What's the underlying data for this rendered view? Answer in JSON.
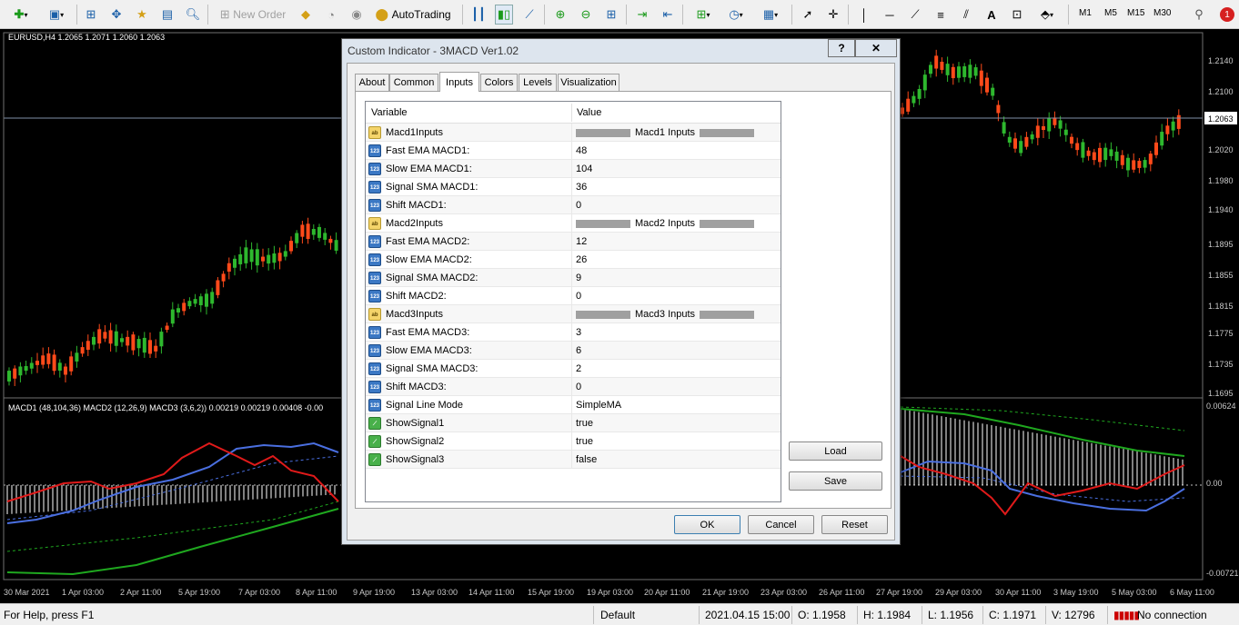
{
  "toolbar": {
    "new_order": "New Order",
    "autotrading": "AutoTrading",
    "timeframes": [
      "M1",
      "M5",
      "M15",
      "M30"
    ],
    "notification_count": "1"
  },
  "chart": {
    "symbol_info": "EURUSD,H4  1.2065 1.2071 1.2060 1.2063",
    "current_price": "1.2063",
    "price_labels": [
      "1.2140",
      "1.2100",
      "1.2020",
      "1.1980",
      "1.1940",
      "1.1895",
      "1.1855",
      "1.1815",
      "1.1775",
      "1.1735",
      "1.1695"
    ],
    "indicator_info": "MACD1 (48,104,36) MACD2 (12,26,9) MACD3 (3,6,2)) 0.00219 0.00219 0.00408 -0.00",
    "indicator_labels": [
      "0.00624",
      "0.00",
      "-0.00721"
    ],
    "time_labels": [
      "30 Mar 2021",
      "1 Apr 03:00",
      "2 Apr 11:00",
      "5 Apr 19:00",
      "7 Apr 03:00",
      "8 Apr 11:00",
      "9 Apr 19:00",
      "13 Apr 03:00",
      "14 Apr 11:00",
      "15 Apr 19:00",
      "19 Apr 03:00",
      "20 Apr 11:00",
      "21 Apr 19:00",
      "23 Apr 03:00",
      "26 Apr 11:00",
      "27 Apr 19:00",
      "29 Apr 03:00",
      "30 Apr 11:00",
      "3 May 19:00",
      "5 May 03:00",
      "6 May 11:00"
    ]
  },
  "dialog": {
    "title": "Custom Indicator - 3MACD Ver1.02",
    "help_button": "?",
    "close_button": "✕",
    "tabs": [
      "About",
      "Common",
      "Inputs",
      "Colors",
      "Levels",
      "Visualization"
    ],
    "active_tab": "Inputs",
    "grid_header": {
      "variable": "Variable",
      "value": "Value"
    },
    "rows": [
      {
        "type": "group",
        "variable": "Macd1Inputs",
        "value": "Macd1 Inputs"
      },
      {
        "type": "number",
        "variable": "Fast EMA MACD1:",
        "value": "48"
      },
      {
        "type": "number",
        "variable": "Slow EMA MACD1:",
        "value": "104"
      },
      {
        "type": "number",
        "variable": "Signal SMA MACD1:",
        "value": "36"
      },
      {
        "type": "number",
        "variable": "Shift MACD1:",
        "value": "0"
      },
      {
        "type": "group",
        "variable": "Macd2Inputs",
        "value": "Macd2 Inputs"
      },
      {
        "type": "number",
        "variable": "Fast EMA MACD2:",
        "value": "12"
      },
      {
        "type": "number",
        "variable": "Slow EMA MACD2:",
        "value": "26"
      },
      {
        "type": "number",
        "variable": "Signal SMA MACD2:",
        "value": "9"
      },
      {
        "type": "number",
        "variable": "Shift MACD2:",
        "value": "0"
      },
      {
        "type": "group",
        "variable": "Macd3Inputs",
        "value": "Macd3 Inputs"
      },
      {
        "type": "number",
        "variable": "Fast EMA MACD3:",
        "value": "3"
      },
      {
        "type": "number",
        "variable": "Slow EMA MACD3:",
        "value": "6"
      },
      {
        "type": "number",
        "variable": "Signal SMA MACD3:",
        "value": "2"
      },
      {
        "type": "number",
        "variable": "Shift MACD3:",
        "value": "0"
      },
      {
        "type": "number",
        "variable": "Signal Line Mode",
        "value": "SimpleMA"
      },
      {
        "type": "bool",
        "variable": "ShowSignal1",
        "value": "true"
      },
      {
        "type": "bool",
        "variable": "ShowSignal2",
        "value": "true"
      },
      {
        "type": "bool",
        "variable": "ShowSignal3",
        "value": "false"
      }
    ],
    "load_button": "Load",
    "save_button": "Save",
    "ok_button": "OK",
    "cancel_button": "Cancel",
    "reset_button": "Reset"
  },
  "statusbar": {
    "help": "For Help, press F1",
    "profile": "Default",
    "datetime": "2021.04.15 15:00",
    "open": "O: 1.1958",
    "high": "H: 1.1984",
    "low": "L: 1.1956",
    "close": "C: 1.1971",
    "volume": "V: 12796",
    "connection": "No connection"
  },
  "colors": {
    "bull": "#2eb82e",
    "bear": "#ff4a1a",
    "macd_blue": "#4a6fe0",
    "macd_red": "#e01a1a",
    "macd_green": "#1fa81f"
  }
}
